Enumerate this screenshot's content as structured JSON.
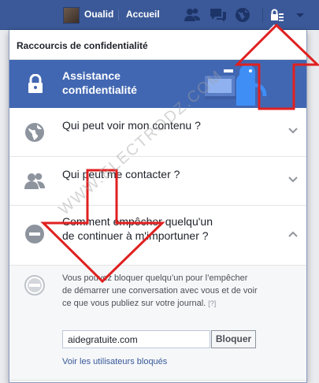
{
  "topbar": {
    "username": "Oualid",
    "home": "Accueil",
    "icons": [
      "friends-icon",
      "messages-icon",
      "notifications-globe-icon",
      "privacy-shortcuts-icon",
      "account-menu-arrow-icon"
    ]
  },
  "panel": {
    "title": "Raccourcis de confidentialité",
    "assistant": {
      "label_line1": "Assistance",
      "label_line2": "confidentialité"
    },
    "rows": [
      {
        "label": "Qui peut voir mon contenu ?"
      },
      {
        "label": "Qui peut me contacter ?"
      },
      {
        "label": "Comment empêcher quelqu'un de continuer à m'importuner ?"
      }
    ],
    "block": {
      "description": "Vous pouvez bloquer quelqu’un pour l’empêcher de démarrer une conversation avec vous et de voir ce que vous publiez sur votre journal.",
      "help": "[?]",
      "input_value": "aidegratuite.com",
      "button": "Bloquer",
      "link": "Voir les utilisateurs bloqués"
    }
  },
  "watermark": "WWW.ELECTRODZ.COM",
  "colors": {
    "facebook_blue": "#3b5998",
    "assistant_blue": "#4267b2",
    "arrow_red": "#e02020"
  }
}
